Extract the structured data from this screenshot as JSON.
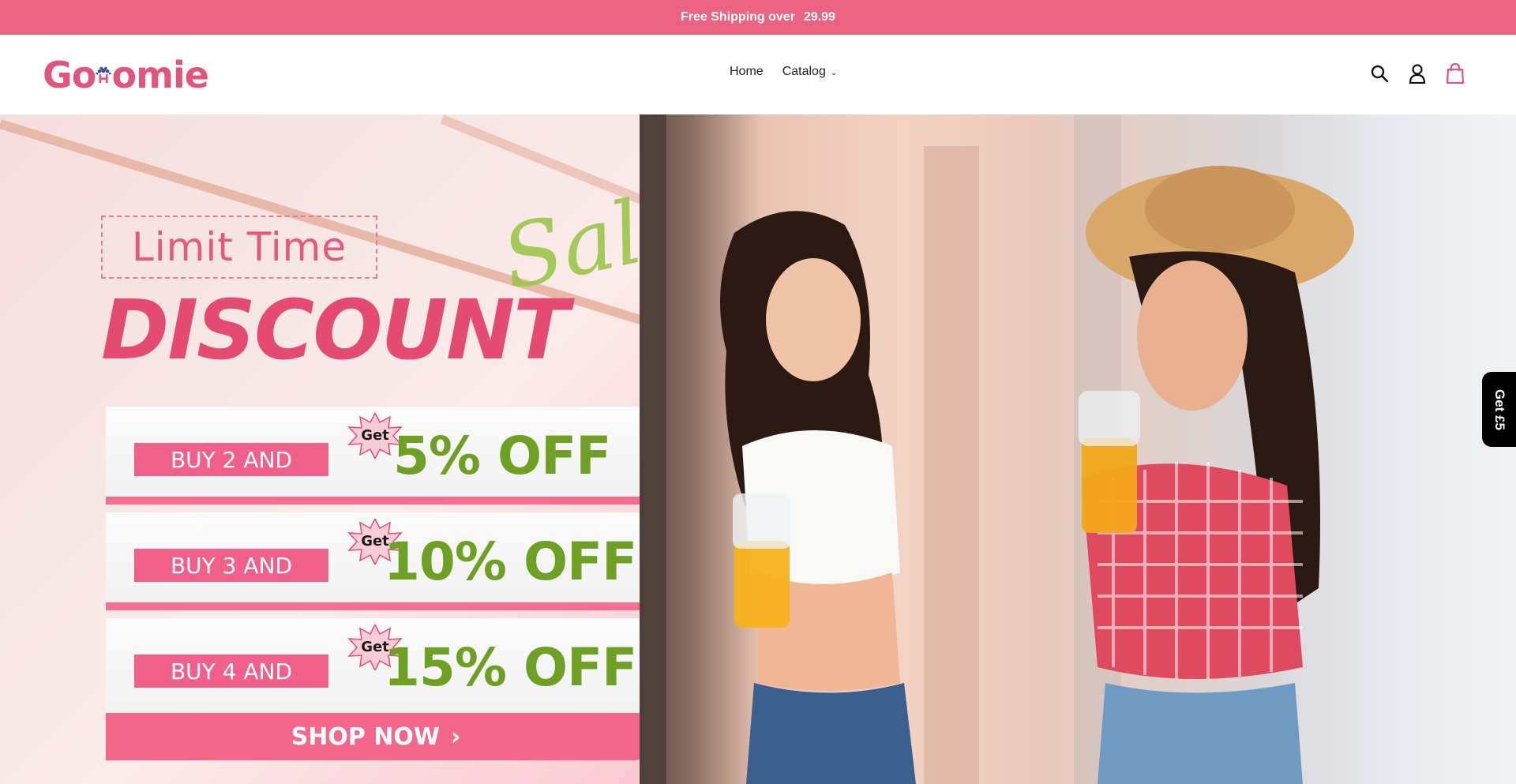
{
  "announcement": {
    "text": "Free Shipping over",
    "amount": "29.99"
  },
  "header": {
    "logo_left": "Go",
    "logo_right": "omie",
    "nav": [
      {
        "label": "Home"
      },
      {
        "label": "Catalog"
      }
    ],
    "icons": [
      "search-icon",
      "account-icon",
      "cart-icon"
    ]
  },
  "hero": {
    "limit_time": "Limit Time",
    "sale": "Sale",
    "discount": "DISCOUNT",
    "offers": [
      {
        "buy": "BUY 2 AND",
        "get": "Get",
        "off": "5% OFF"
      },
      {
        "buy": "BUY 3 AND",
        "get": "Get",
        "off": "10% OFF"
      },
      {
        "buy": "BUY 4 AND",
        "get": "Get",
        "off": "15% OFF"
      }
    ],
    "shop_now": "SHOP NOW",
    "shop_now_arrow": "›"
  },
  "side_tab": {
    "label": "Get £5"
  },
  "colors": {
    "brand_pink": "#ec6282",
    "green": "#6ea023",
    "cart_pink": "#e0557c"
  }
}
